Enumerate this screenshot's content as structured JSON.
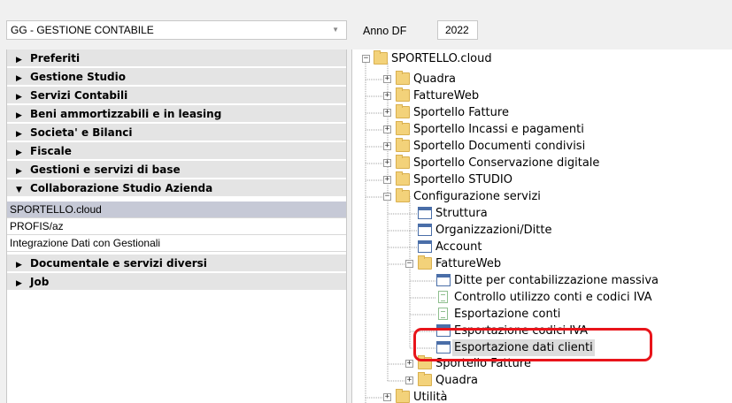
{
  "header": {
    "module": "GG - GESTIONE CONTABILE",
    "anno_label": "Anno DF",
    "anno_value": "2022"
  },
  "menu": {
    "items": [
      "Preferiti",
      "Gestione Studio",
      "Servizi Contabili",
      "Beni ammortizzabili e in leasing",
      "Societa' e Bilanci",
      "Fiscale",
      "Gestioni e servizi di base",
      "Collaborazione Studio Azienda"
    ],
    "sub_items": [
      "SPORTELLO.cloud",
      "PROFIS/az",
      "Integrazione Dati con Gestionali"
    ],
    "items_after": [
      "Documentale e servizi diversi",
      "Job"
    ]
  },
  "tree": {
    "root": "SPORTELLO.cloud",
    "nodes": [
      "Quadra",
      "FattureWeb",
      "Sportello Fatture",
      "Sportello Incassi e pagamenti",
      "Sportello Documenti condivisi",
      "Sportello Conservazione digitale",
      "Sportello STUDIO",
      "Configurazione servizi",
      "Struttura",
      "Organizzazioni/Ditte",
      "Account",
      "FattureWeb",
      "Ditte per contabilizzazione massiva",
      "Controllo utilizzo conti e codici IVA",
      "Esportazione conti",
      "Esportazione codici IVA",
      "Esportazione dati clienti",
      "Sportello Fatture",
      "Quadra",
      "Utilità"
    ]
  },
  "colors": {
    "selected_menu": "#c6c9d6",
    "highlight_border": "#e8141a",
    "folder": "#f3d27a"
  }
}
